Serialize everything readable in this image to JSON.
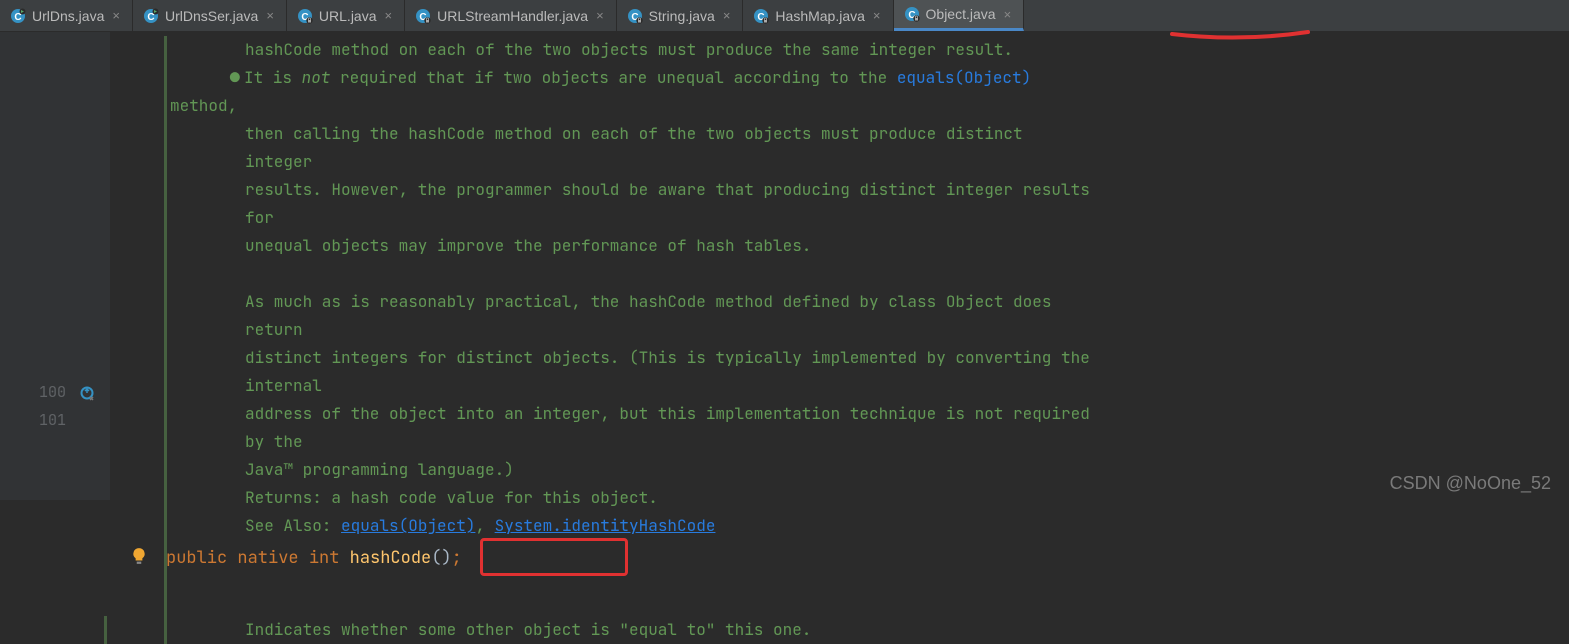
{
  "tabs": [
    {
      "label": "UrlDns.java",
      "icon": "class-run",
      "locked": false,
      "active": false
    },
    {
      "label": "UrlDnsSer.java",
      "icon": "class-run",
      "locked": false,
      "active": false
    },
    {
      "label": "URL.java",
      "icon": "class",
      "locked": true,
      "active": false
    },
    {
      "label": "URLStreamHandler.java",
      "icon": "class",
      "locked": true,
      "active": false
    },
    {
      "label": "String.java",
      "icon": "class",
      "locked": true,
      "active": false
    },
    {
      "label": "HashMap.java",
      "icon": "class",
      "locked": true,
      "active": false
    },
    {
      "label": "Object.java",
      "icon": "class",
      "locked": true,
      "active": true
    }
  ],
  "gutter": {
    "line100": "100",
    "line101": "101"
  },
  "doc": {
    "l1a": "hashCode",
    "l1b": " method on each of the two objects must produce the same integer result.",
    "l2a": "It is ",
    "l2not": "not",
    "l2b": " required that if two objects are unequal according to the ",
    "l2eq": "equals(Object)",
    "l2c": " method,",
    "l3": "then calling the ",
    "l3hc": "hashCode",
    "l3b": " method on each of the two objects must produce distinct integer",
    "l4": "results. However, the programmer should be aware that producing distinct integer results for",
    "l5": "unequal objects may improve the performance of hash tables.",
    "l6a": "As much as is reasonably practical, the hashCode method defined by class ",
    "l6obj": "Object",
    "l6b": " does return",
    "l7": "distinct integers for distinct objects. (This is typically implemented by converting the internal",
    "l8": "address of the object into an integer, but this implementation technique is not required by the",
    "l9": "Java™ programming language.)",
    "ret_label": "Returns:",
    "ret_text": "  a hash code value for this object.",
    "see_label": "See Also: ",
    "see_eq": "equals(Object)",
    "see_sep": ", ",
    "see_id": "System.identityHashCode",
    "next": "Indicates whether some other object is \"equal to\" this one."
  },
  "code": {
    "kw_public": "public",
    "kw_native": "native",
    "kw_int": "int",
    "method": "hashCode",
    "parens": "()",
    "semi": ";"
  },
  "watermark": "CSDN @NoOne_52"
}
